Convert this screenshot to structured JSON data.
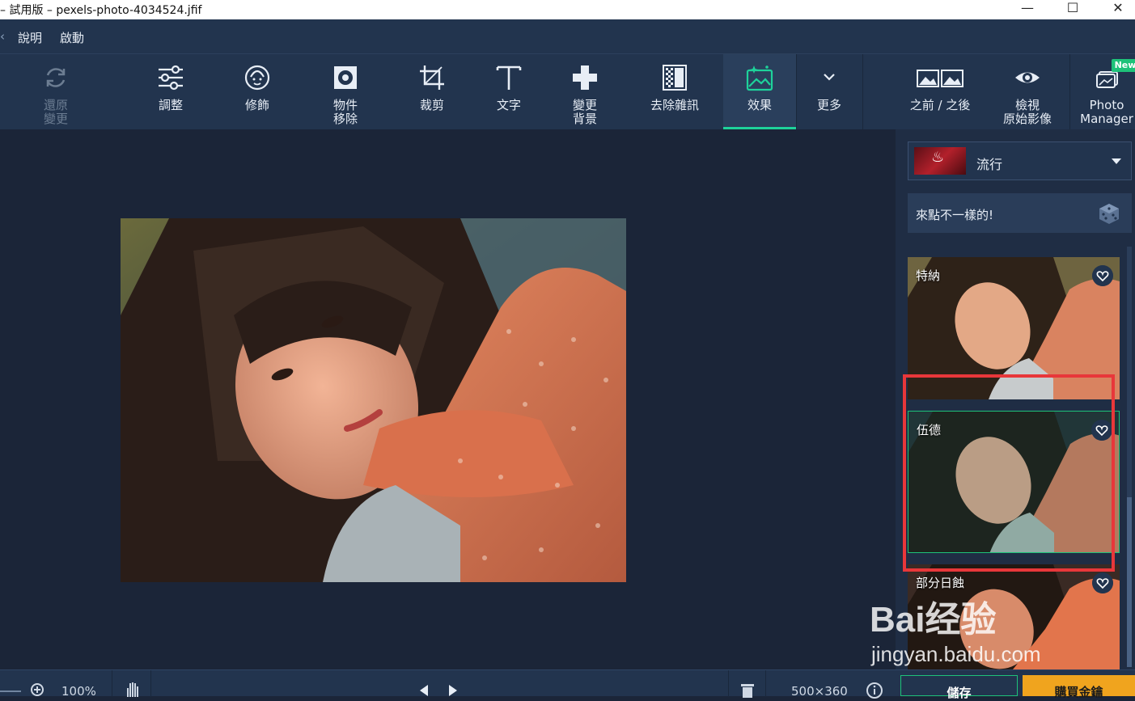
{
  "window": {
    "title": "– 試用版 – pexels-photo-4034524.jfif",
    "minimize_glyph": "—",
    "maximize_glyph": "☐",
    "close_glyph": "✕"
  },
  "menu": {
    "items": [
      "說明",
      "啟動"
    ]
  },
  "toolbar": {
    "undo": "還原\n變更",
    "adjust": "調整",
    "retouch": "修飾",
    "object_removal": "物件\n移除",
    "crop": "裁剪",
    "text": "文字",
    "change_bg": "變更\n背景",
    "denoise": "去除雜訊",
    "effects": "效果",
    "more": "更多",
    "before_after": "之前 / 之後",
    "view_original": "檢視\n原始影像",
    "photo_manager": "Photo\nManager",
    "new_badge": "New"
  },
  "effects_panel": {
    "category": "流行",
    "random_label": "來點不一樣的!",
    "effects": [
      {
        "name": "特納"
      },
      {
        "name": "伍德"
      },
      {
        "name": "部分日蝕"
      }
    ]
  },
  "status": {
    "zoom": "100%",
    "dimensions": "500×360",
    "save": "儲存",
    "buy": "購買金鑰"
  },
  "watermark": {
    "top": "Bai经验",
    "bottom": "jingyan.baidu.com"
  },
  "colors": {
    "accent": "#1ed29a",
    "highlight": "#e8373a",
    "buy": "#f0a41e",
    "panel": "#22344e"
  }
}
